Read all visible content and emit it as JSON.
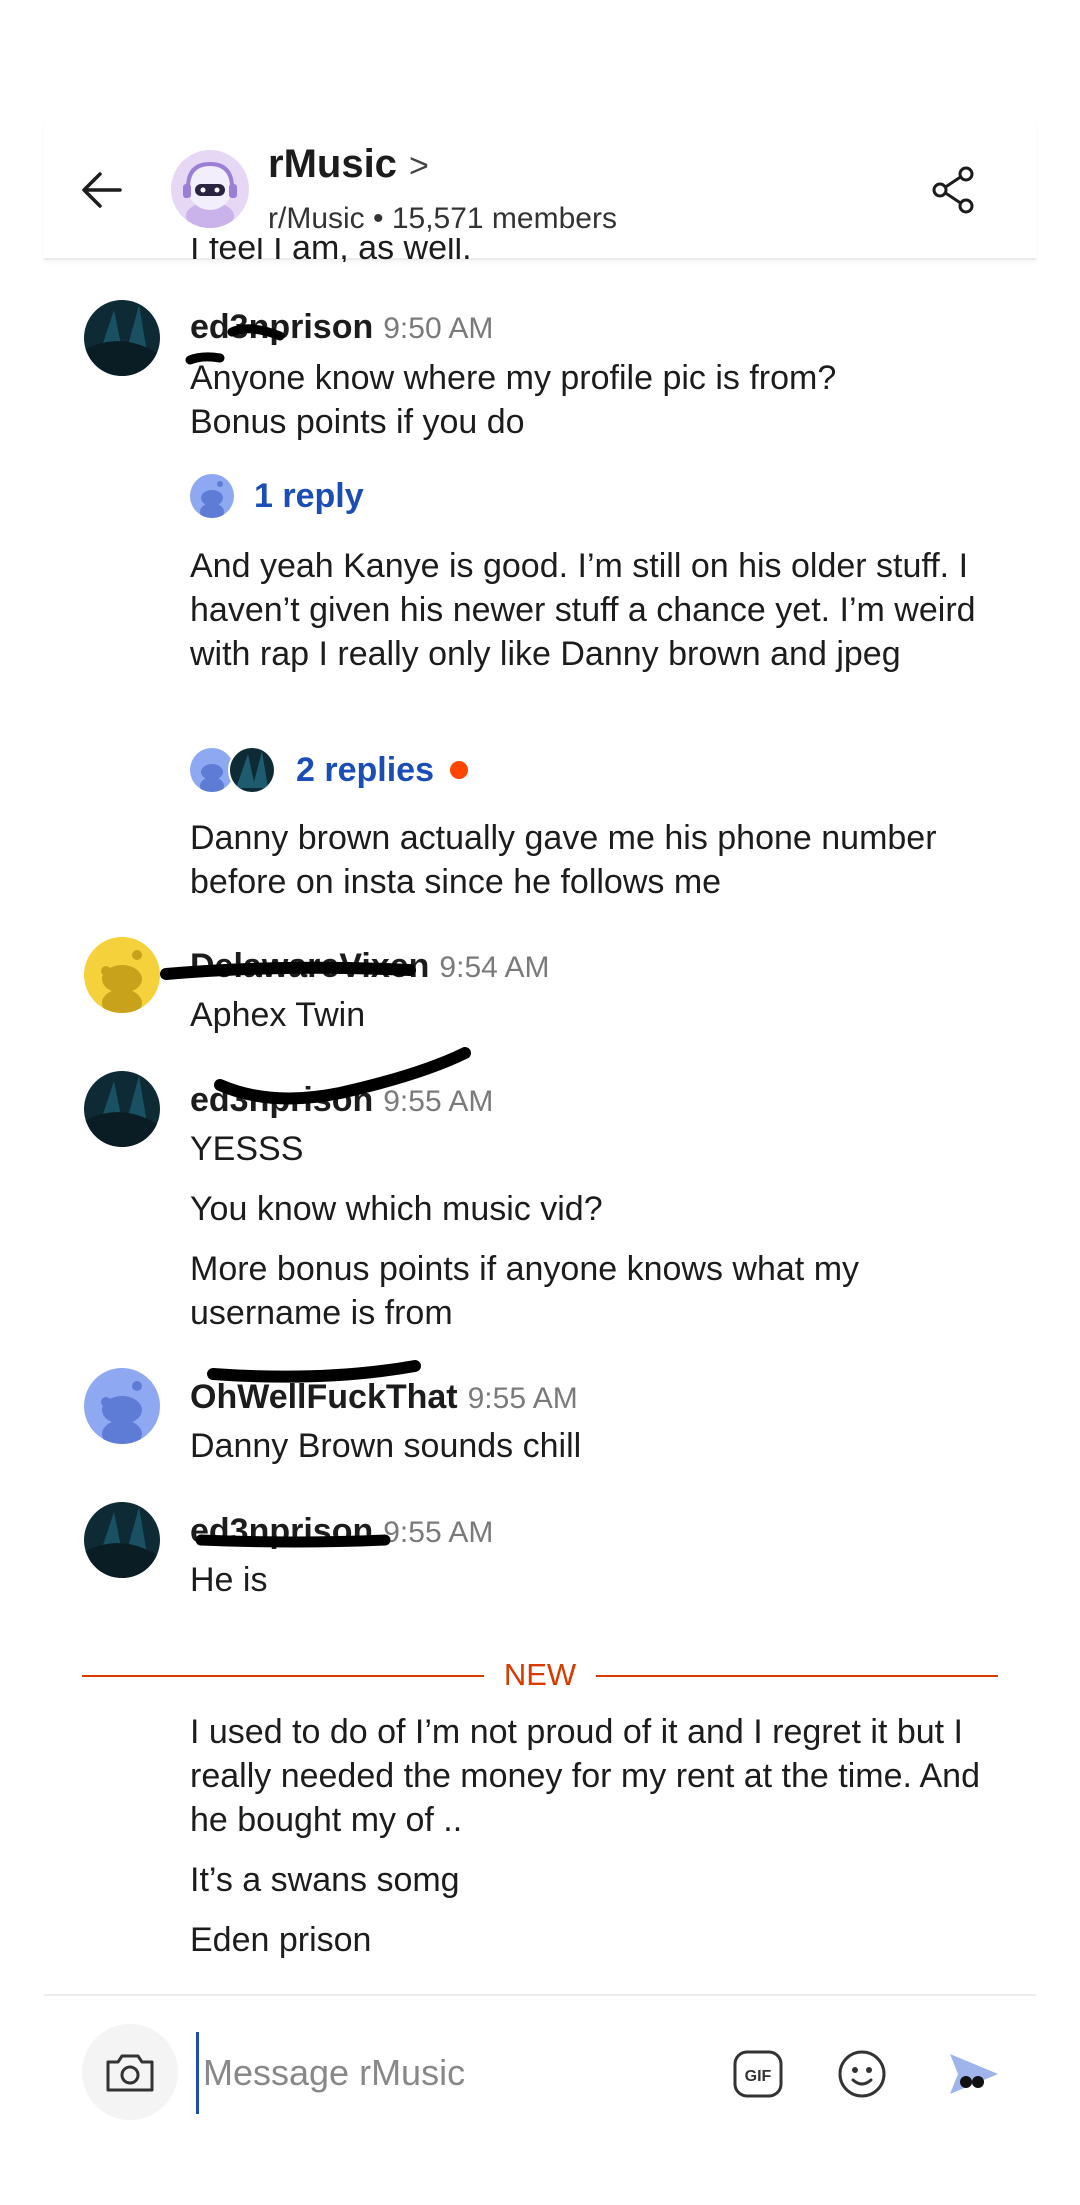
{
  "header": {
    "title": "rMusic",
    "chevron": ">",
    "subtitle": "r/Music • 15,571 members"
  },
  "cutoff_text": "I feel I am, as well.",
  "messages": [
    {
      "username": "ed3nprison",
      "time": "9:50 AM",
      "lines": [
        "Anyone know where my profile pic is from?\nBonus points if you do"
      ],
      "reply1_label": "1 reply",
      "text2": "And yeah Kanye is good. I’m still on his older stuff. I haven’t given his newer stuff a chance yet. I’m weird with rap I really only like Danny brown and jpeg",
      "reply2_label": "2 replies",
      "text3": "Danny brown actually gave me his phone number before on insta since he follows me"
    },
    {
      "username": "DelawareVixen",
      "time": "9:54 AM",
      "text": "Aphex Twin"
    },
    {
      "username": "ed3nprison",
      "time": "9:55 AM",
      "line1": "YESSS",
      "line2": "You know which music vid?",
      "line3": "More bonus points if anyone knows what my username is from"
    },
    {
      "username": "OhWellFuckThat",
      "time": "9:55 AM",
      "text": "Danny Brown sounds chill"
    },
    {
      "username": "ed3nprison",
      "time": "9:55 AM",
      "text": "He is"
    }
  ],
  "new_label": "NEW",
  "new_messages": {
    "line1": "I used to do of I’m not proud of it and I regret it but I really needed the money for my rent at the time. And he bought my of ..",
    "line2": "It’s a swans somg",
    "line3": "Eden prison"
  },
  "composer": {
    "placeholder": "Message rMusic",
    "gif_label": "GIF"
  },
  "colors": {
    "accent_blue": "#1a4db5",
    "new_orange": "#d93a00",
    "dot_orange": "#ff4500",
    "snoo_blue": "#8fa8f2",
    "snoo_yellow": "#f5d23b"
  },
  "icons": [
    "back-arrow-icon",
    "chevron-right-icon",
    "share-icon",
    "camera-icon",
    "gif-icon",
    "emoji-icon",
    "send-icon"
  ]
}
